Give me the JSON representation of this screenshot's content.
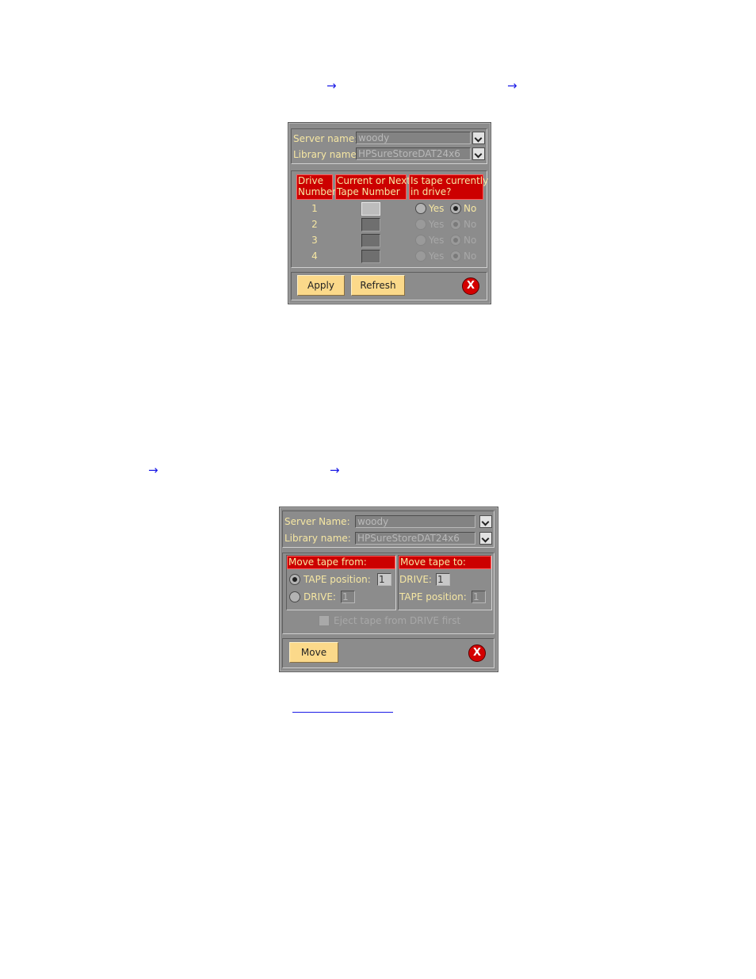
{
  "doc": {
    "arrow_glyph": "→"
  },
  "dialog1": {
    "server_label": "Server name:",
    "server_value": "woody",
    "library_label": "Library name:",
    "library_value": "HPSureStoreDAT24x6",
    "columns": [
      [
        "Drive",
        "Number"
      ],
      [
        "Current or Next",
        "Tape Number"
      ],
      [
        "Is tape currently",
        "in drive?"
      ]
    ],
    "rows": [
      {
        "drive": "1",
        "enabled": true,
        "selected": "No"
      },
      {
        "drive": "2",
        "enabled": false,
        "selected": "No"
      },
      {
        "drive": "3",
        "enabled": false,
        "selected": "No"
      },
      {
        "drive": "4",
        "enabled": false,
        "selected": "No"
      }
    ],
    "yes_label": "Yes",
    "no_label": "No",
    "apply_label": "Apply",
    "refresh_label": "Refresh",
    "close_glyph": "X"
  },
  "dialog2": {
    "server_label": "Server Name:",
    "server_value": "woody",
    "library_label": "Library name:",
    "library_value": "HPSureStoreDAT24x6",
    "from_header": "Move tape from:",
    "to_header": "Move tape to:",
    "from_tape_label": "TAPE position:",
    "from_tape_value": "1",
    "from_drive_label": "DRIVE:",
    "from_drive_value": "1",
    "to_drive_label": "DRIVE:",
    "to_drive_value": "1",
    "to_tape_label": "TAPE position:",
    "to_tape_value": "1",
    "eject_label": "Eject tape from DRIVE first",
    "move_label": "Move",
    "close_glyph": "X"
  }
}
